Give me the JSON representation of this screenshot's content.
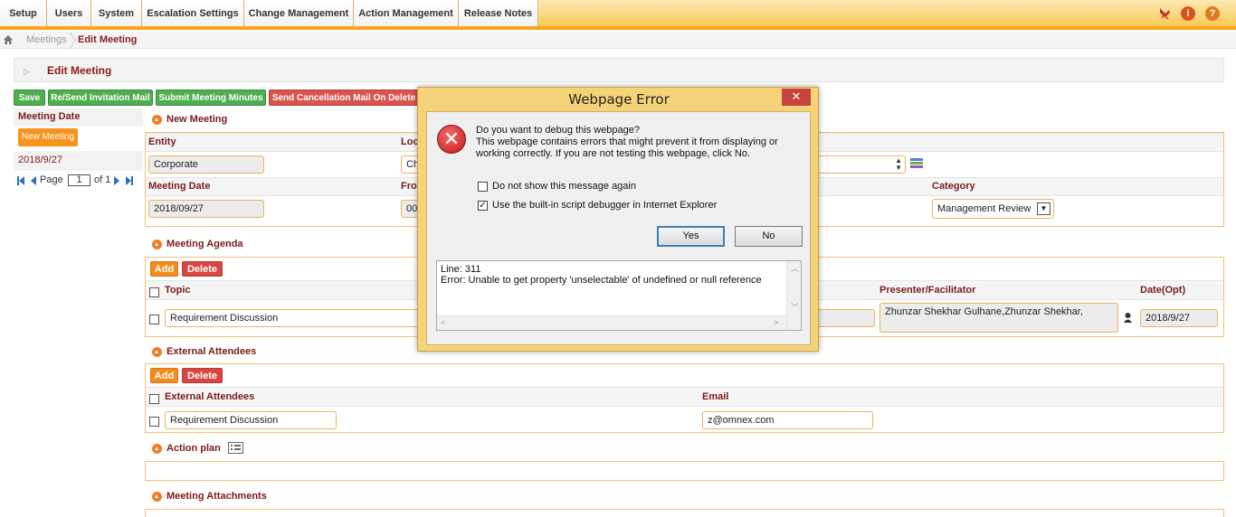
{
  "nav": {
    "tabs": [
      "Setup",
      "Users",
      "System",
      "Escalation Settings",
      "Change Management",
      "Action Management",
      "Release Notes"
    ],
    "icons": [
      "pin-icon",
      "info-icon",
      "help-icon"
    ]
  },
  "breadcrumb": {
    "home": "home-icon",
    "items": [
      "Meetings",
      "Edit Meeting"
    ]
  },
  "page": {
    "title": "Edit Meeting"
  },
  "actions": {
    "save": "Save",
    "resend": "Re/Send Invitation Mail",
    "submit_minutes": "Submit Meeting Minutes",
    "cancel_mail": "Send Cancellation Mail On Delete"
  },
  "left_panel": {
    "header": "Meeting Date",
    "new_button": "New Meeting",
    "date": "2018/9/27",
    "pager": {
      "label": "Page",
      "value": "1",
      "of": "of 1"
    }
  },
  "new_meeting": {
    "title": "New Meeting",
    "entity_label": "Entity",
    "location_label_partial": "Loc",
    "entity_value": "Corporate",
    "location_value_partial": "Ch",
    "meeting_date_label": "Meeting Date",
    "from_label_partial": "Fro",
    "meeting_date_value": "2018/09/27",
    "from_value_partial": "00",
    "category_label": "Category",
    "category_value": "Management Review"
  },
  "agenda": {
    "title": "Meeting Agenda",
    "add": "Add",
    "delete": "Delete",
    "col_topic": "Topic",
    "col_presenter": "Presenter/Facilitator",
    "col_date": "Date(Opt)",
    "row": {
      "topic": "Requirement Discussion",
      "presenter": "Zhunzar Shekhar Gulhane,Zhunzar    Shekhar,",
      "date": "2018/9/27"
    }
  },
  "external": {
    "title": "External Attendees",
    "add": "Add",
    "delete": "Delete",
    "col_name": "External Attendees",
    "col_email": "Email",
    "row": {
      "name": "Requirement Discussion",
      "email": "z@omnex.com"
    }
  },
  "action_plan": {
    "title": "Action plan"
  },
  "attachments": {
    "title": "Meeting Attachments"
  },
  "dialog": {
    "title": "Webpage Error",
    "close": "✕",
    "question": "Do you want to debug this webpage?",
    "line1": "This webpage contains errors that might prevent it from displaying or",
    "line2": "working correctly. If you are not testing this webpage, click No.",
    "opt1": "Do not show this message again",
    "opt2": "Use the built-in script debugger in Internet Explorer",
    "opt1_checked": false,
    "opt2_checked": true,
    "yes": "Yes",
    "no": "No",
    "log_line": "Line: 311",
    "log_error": "Error: Unable to get property 'unselectable' of undefined or null reference"
  },
  "colors": {
    "accent": "#f7a51a",
    "heading": "#7b1a1a",
    "green": "#4fae4f",
    "red": "#d9534f",
    "orange": "#f48c1c"
  }
}
